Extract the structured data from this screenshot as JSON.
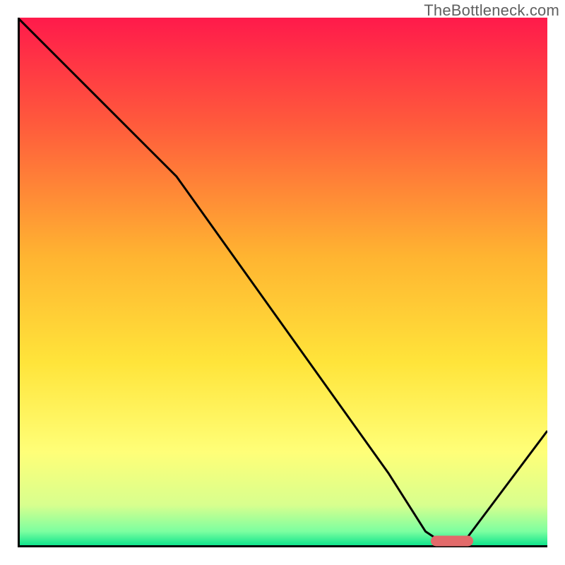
{
  "watermark": "TheBottleneck.com",
  "chart_data": {
    "type": "line",
    "title": "",
    "xlabel": "",
    "ylabel": "",
    "xlim": [
      0,
      100
    ],
    "ylim": [
      0,
      100
    ],
    "grid": false,
    "legend": false,
    "background_gradient": {
      "stops": [
        {
          "pos": 0.0,
          "color": "#ff1a4b"
        },
        {
          "pos": 0.2,
          "color": "#ff5a3c"
        },
        {
          "pos": 0.45,
          "color": "#ffb431"
        },
        {
          "pos": 0.65,
          "color": "#ffe43a"
        },
        {
          "pos": 0.82,
          "color": "#ffff78"
        },
        {
          "pos": 0.92,
          "color": "#d8ff8e"
        },
        {
          "pos": 0.97,
          "color": "#7cffa0"
        },
        {
          "pos": 1.0,
          "color": "#00e089"
        }
      ]
    },
    "series": [
      {
        "name": "curve",
        "color": "#000000",
        "x": [
          0,
          10,
          25,
          30,
          50,
          70,
          77,
          80,
          83,
          85,
          100
        ],
        "y": [
          100,
          90,
          75,
          70,
          42,
          14,
          3,
          1,
          1,
          2,
          22
        ]
      }
    ],
    "marker": {
      "name": "optimal-range",
      "color": "#e26a6a",
      "x_start": 78,
      "x_end": 86,
      "y": 1.2,
      "thickness_pct": 2.0
    }
  }
}
